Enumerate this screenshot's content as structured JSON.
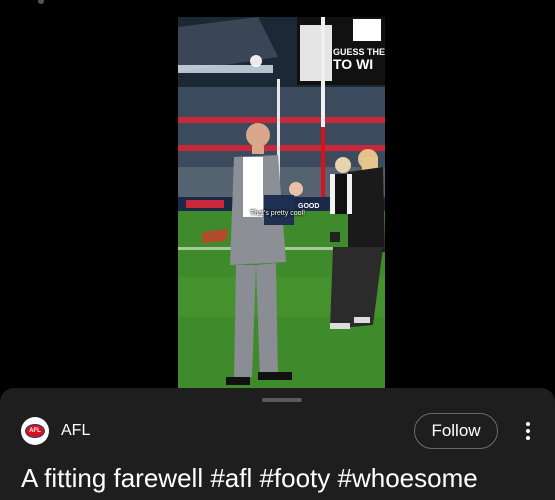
{
  "video": {
    "caption": "That's pretty cool!",
    "screen_text_line1": "GUESS THE CRO",
    "screen_text_line2": "TO WI",
    "board_text": "GOOD"
  },
  "channel": {
    "name": "AFL",
    "avatar_text": "AFL"
  },
  "actions": {
    "follow_label": "Follow",
    "more_icon": "more-vert-icon"
  },
  "post": {
    "title": "A fitting farewell #afl #footy #whoesome"
  },
  "colors": {
    "sheet_bg": "#1e1e1e",
    "grass": "#3f8a2a",
    "afl_red": "#d8121a"
  }
}
